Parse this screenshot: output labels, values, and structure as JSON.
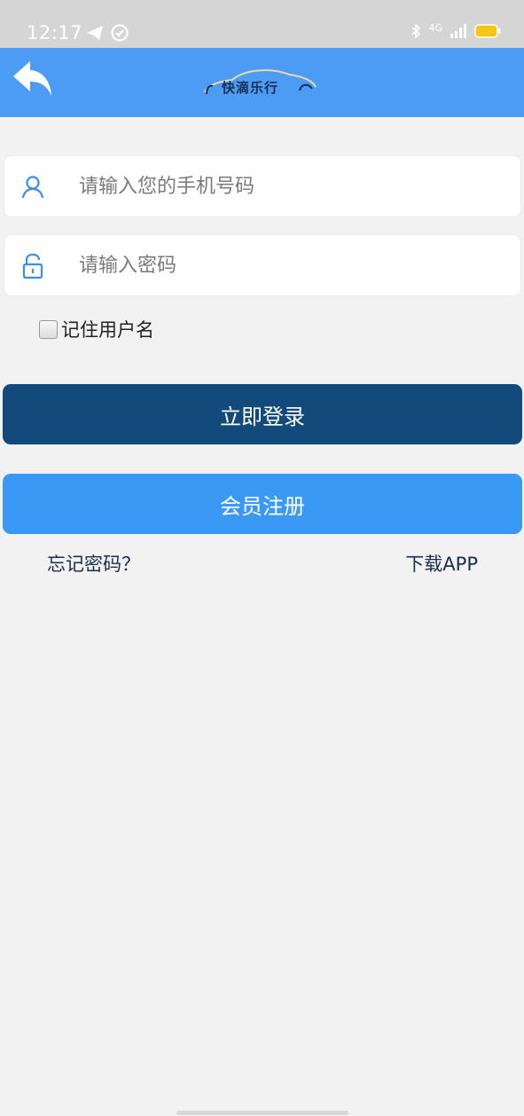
{
  "status_bar": {
    "time": "12:17",
    "network": "4G"
  },
  "header": {
    "logo_text": "快滴乐行"
  },
  "form": {
    "phone_placeholder": "请输入您的手机号码",
    "password_placeholder": "请输入密码",
    "remember_label": "记住用户名"
  },
  "buttons": {
    "login": "立即登录",
    "register": "会员注册"
  },
  "links": {
    "forgot": "忘记密码？",
    "download": "下载APP"
  },
  "colors": {
    "header": "#4c9bf5",
    "login_button": "#124b7b",
    "register_button": "#3b99f6",
    "icon": "#3a8ee6"
  },
  "icons": {
    "back": "back-arrow-icon",
    "user": "user-icon",
    "lock": "lock-icon"
  }
}
